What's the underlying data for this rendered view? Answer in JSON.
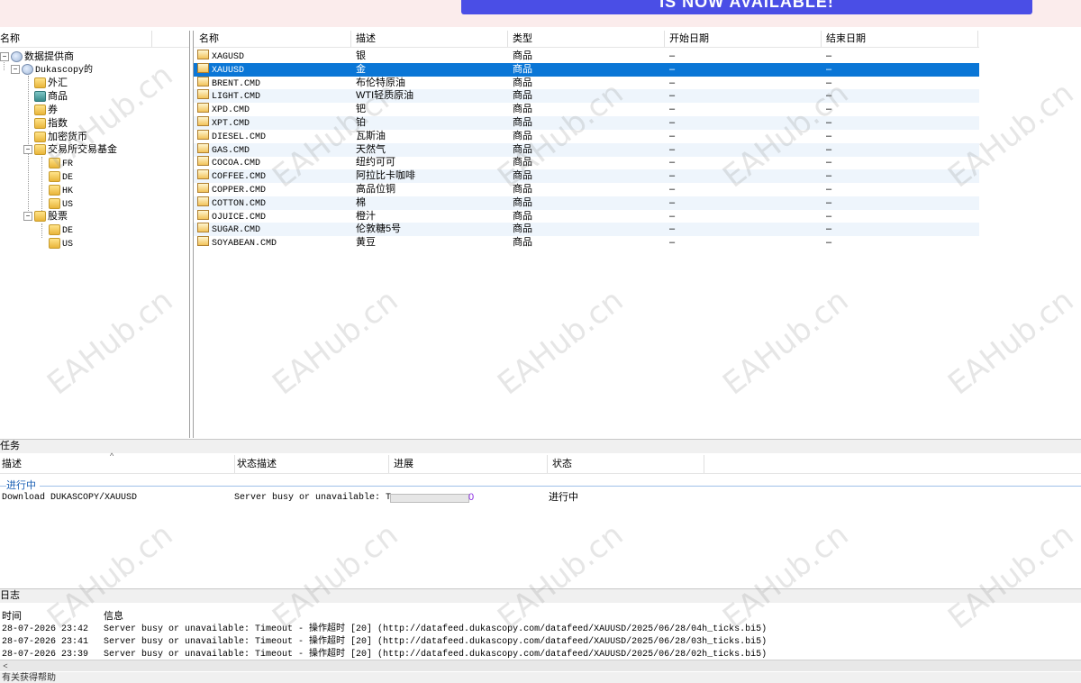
{
  "banner": {
    "text": "IS NOW AVAILABLE!"
  },
  "tree": {
    "header": "名称",
    "root": "数据提供商",
    "provider": "Dukascopy的",
    "items": [
      "外汇",
      "商品",
      "券",
      "指数",
      "加密货币",
      "交易所交易基金",
      "FR",
      "DE",
      "HK",
      "US",
      "股票",
      "DE",
      "US"
    ]
  },
  "list": {
    "headers": [
      "名称",
      "描述",
      "类型",
      "开始日期",
      "结束日期"
    ],
    "rows": [
      {
        "name": "XAGUSD",
        "desc": "银",
        "type": "商品",
        "start": "–",
        "end": "–"
      },
      {
        "name": "XAUUSD",
        "desc": "金",
        "type": "商品",
        "start": "–",
        "end": "–"
      },
      {
        "name": "BRENT.CMD",
        "desc": "布伦特原油",
        "type": "商品",
        "start": "–",
        "end": "–"
      },
      {
        "name": "LIGHT.CMD",
        "desc": "WTI轻质原油",
        "type": "商品",
        "start": "–",
        "end": "–"
      },
      {
        "name": "XPD.CMD",
        "desc": "钯",
        "type": "商品",
        "start": "–",
        "end": "–"
      },
      {
        "name": "XPT.CMD",
        "desc": "铂",
        "type": "商品",
        "start": "–",
        "end": "–"
      },
      {
        "name": "DIESEL.CMD",
        "desc": "瓦斯油",
        "type": "商品",
        "start": "–",
        "end": "–"
      },
      {
        "name": "GAS.CMD",
        "desc": "天然气",
        "type": "商品",
        "start": "–",
        "end": "–"
      },
      {
        "name": "COCOA.CMD",
        "desc": "纽约可可",
        "type": "商品",
        "start": "–",
        "end": "–"
      },
      {
        "name": "COFFEE.CMD",
        "desc": "阿拉比卡咖啡",
        "type": "商品",
        "start": "–",
        "end": "–"
      },
      {
        "name": "COPPER.CMD",
        "desc": "高品位铜",
        "type": "商品",
        "start": "–",
        "end": "–"
      },
      {
        "name": "COTTON.CMD",
        "desc": "棉",
        "type": "商品",
        "start": "–",
        "end": "–"
      },
      {
        "name": "OJUICE.CMD",
        "desc": "橙汁",
        "type": "商品",
        "start": "–",
        "end": "–"
      },
      {
        "name": "SUGAR.CMD",
        "desc": "伦敦糖5号",
        "type": "商品",
        "start": "–",
        "end": "–"
      },
      {
        "name": "SOYABEAN.CMD",
        "desc": "黄豆",
        "type": "商品",
        "start": "–",
        "end": "–"
      }
    ]
  },
  "tasks": {
    "title": "任务",
    "headers": [
      "描述",
      "状态描述",
      "进展",
      "状态"
    ],
    "group": "进行中",
    "row": {
      "desc": "Download DUKASCOPY/XAUUSD",
      "status_desc": "Server busy or unavailable: T...",
      "progress_value": "0",
      "progress_fraction": 0,
      "state": "进行中"
    }
  },
  "log": {
    "title": "日志",
    "headers": [
      "时间",
      "信息"
    ],
    "rows": [
      {
        "time": "28-07-2026 23:42",
        "msg": "Server busy or unavailable: Timeout - 操作超时 [20] (http://datafeed.dukascopy.com/datafeed/XAUUSD/2025/06/28/04h_ticks.bi5)"
      },
      {
        "time": "28-07-2026 23:41",
        "msg": "Server busy or unavailable: Timeout - 操作超时 [20] (http://datafeed.dukascopy.com/datafeed/XAUUSD/2025/06/28/03h_ticks.bi5)"
      },
      {
        "time": "28-07-2026 23:39",
        "msg": "Server busy or unavailable: Timeout - 操作超时 [20] (http://datafeed.dukascopy.com/datafeed/XAUUSD/2025/06/28/02h_ticks.bi5)"
      }
    ]
  },
  "status": {
    "text": "有关获得帮助"
  },
  "watermark": "EAHub.cn",
  "colors": {
    "selection": "#0a76d6",
    "progress_text": "#8a2be2",
    "group": "#1a5fb4"
  }
}
